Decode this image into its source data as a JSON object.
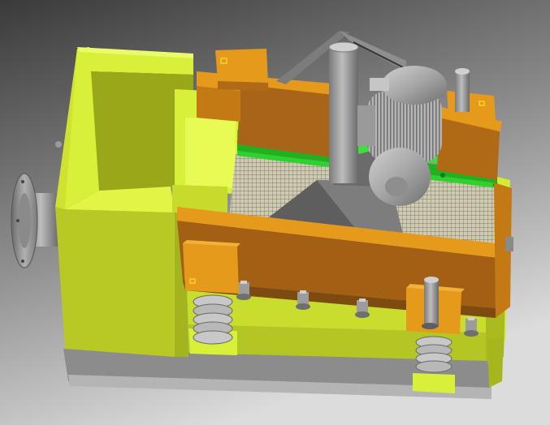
{
  "scene": {
    "subject": "shale-shaker-cad-model",
    "colors": {
      "background_top": "#3a3a3a",
      "background_bottom": "#d8d8d8",
      "housing": "#d9f03a",
      "housing_shadow": "#a9b81f",
      "housing_dark": "#7d8a12",
      "deck": "#c47a14",
      "deck_dark": "#8a5a12",
      "deck_light": "#e69a1c",
      "motor": "#a6a6a6",
      "motor_dark": "#6e6e6e",
      "screen_rail": "#2fd12f",
      "screen_mesh": "#b7b49a",
      "base": "#9a9a9a",
      "spring": "#c0c0c0"
    }
  }
}
